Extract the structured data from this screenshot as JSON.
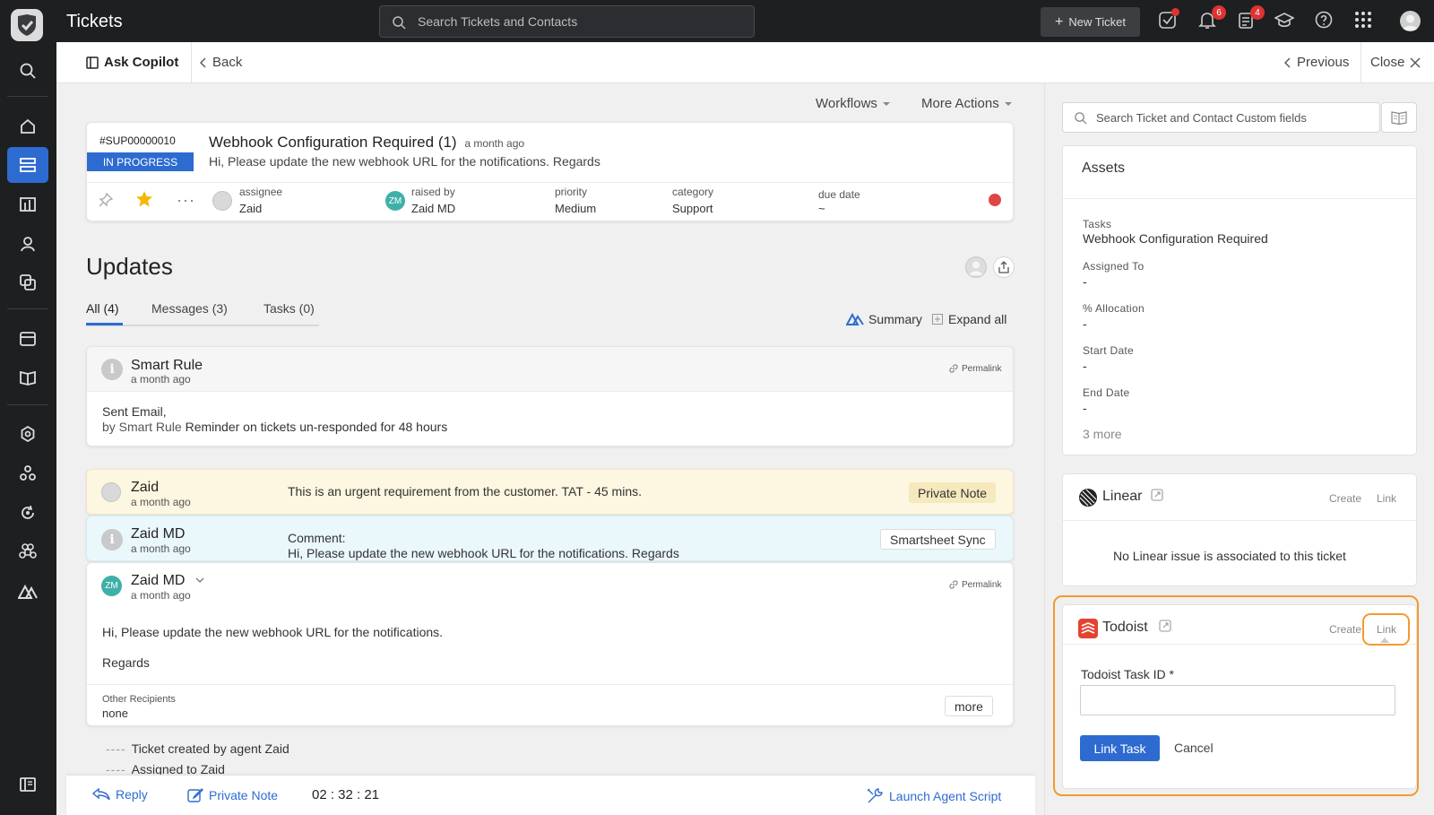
{
  "topbar": {
    "title": "Tickets",
    "search_placeholder": "Search Tickets and Contacts",
    "new_ticket": "New Ticket",
    "todo_badge": "",
    "notifications_badge": "6",
    "tasks_badge": "4"
  },
  "subheader": {
    "ask_copilot": "Ask Copilot",
    "back": "Back",
    "previous": "Previous",
    "close": "Close"
  },
  "actions": {
    "workflows": "Workflows",
    "more_actions": "More Actions"
  },
  "ticket": {
    "id": "#SUP00000010",
    "status": "IN PROGRESS",
    "title": "Webhook Configuration Required",
    "count": "(1)",
    "ago": "a month ago",
    "description": "Hi, Please update the new webhook URL for the notifications. Regards",
    "assignee_label": "assignee",
    "assignee": "Zaid",
    "raised_by_label": "raised by",
    "raised_by_initials": "ZM",
    "raised_by": "Zaid MD",
    "priority_label": "priority",
    "priority": "Medium",
    "category_label": "category",
    "category": "Support",
    "due_date_label": "due date",
    "due_date": "~"
  },
  "updates": {
    "title": "Updates",
    "tabs": [
      {
        "label": "All (4)"
      },
      {
        "label": "Messages (3)"
      },
      {
        "label": "Tasks (0)"
      }
    ],
    "summary": "Summary",
    "expand_all": "Expand all",
    "smart_rule": {
      "name": "Smart Rule",
      "ago": "a month ago",
      "permalink": "Permalink",
      "line1": "Sent Email,",
      "line2_prefix": "by Smart Rule",
      "line2_rest": " Reminder on tickets un-responded for 48 hours"
    },
    "private_note": {
      "name": "Zaid",
      "ago": "a month ago",
      "text": "This is an urgent requirement from the customer. TAT - 45 mins.",
      "tag": "Private Note"
    },
    "comment": {
      "name": "Zaid MD",
      "ago": "a month ago",
      "line1": "Comment:",
      "line2": "Hi, Please update the new webhook URL for the notifications. Regards",
      "tag": "Smartsheet Sync"
    },
    "message": {
      "initials": "ZM",
      "name": "Zaid MD",
      "ago": "a month ago",
      "permalink": "Permalink",
      "body1": "Hi, Please update the new webhook URL for the notifications.",
      "body2": "Regards",
      "recipients_label": "Other Recipients",
      "recipients": "none",
      "more": "more"
    },
    "timeline": [
      {
        "dash": "----",
        "text": "Ticket created by agent Zaid"
      },
      {
        "dash": "----",
        "text": "Assigned to Zaid"
      }
    ]
  },
  "bottom_bar": {
    "reply": "Reply",
    "private_note": "Private Note",
    "timer": "02 : 32 : 21",
    "launch_script": "Launch Agent Script"
  },
  "right_panel": {
    "search_placeholder": "Search Ticket and Contact Custom fields",
    "assets": {
      "title": "Assets",
      "fields": [
        {
          "label": "Tasks",
          "value": "Webhook Configuration Required"
        },
        {
          "label": "Assigned To",
          "value": "-"
        },
        {
          "label": "% Allocation",
          "value": "-"
        },
        {
          "label": "Start Date",
          "value": "-"
        },
        {
          "label": "End Date",
          "value": "-"
        }
      ],
      "more": "3 more"
    },
    "linear": {
      "title": "Linear",
      "create": "Create",
      "link": "Link",
      "empty": "No Linear issue is associated to this ticket"
    },
    "todoist": {
      "title": "Todoist",
      "create": "Create",
      "link": "Link",
      "task_id_label": "Todoist Task ID *",
      "task_id_value": "",
      "link_task": "Link Task",
      "cancel": "Cancel"
    }
  },
  "colors": {
    "accent": "#2e6bd1",
    "highlight": "#f39a2e",
    "private_note_bg": "#fdf6e0",
    "comment_bg": "#eaf7fb"
  }
}
